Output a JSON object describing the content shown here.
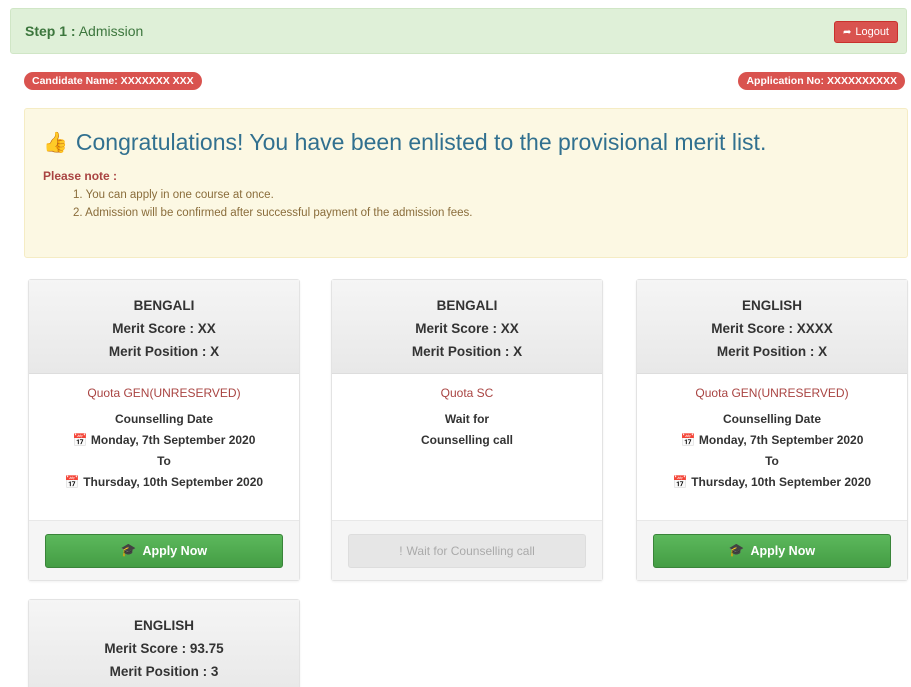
{
  "header": {
    "step_label": "Step 1 :",
    "step_title": "Admission",
    "logout_label": "Logout"
  },
  "candidate": {
    "name_label": "Candidate Name: XXXXXXX XXX",
    "application_label": "Application No: XXXXXXXXXX"
  },
  "notice": {
    "headline": "Congratulations! You have been enlisted to the provisional merit list.",
    "note_label": "Please note :",
    "items": [
      "1. You can apply in one course at once.",
      "2. Admission will be confirmed after successful payment of the admission fees."
    ]
  },
  "cards": [
    {
      "subject": "BENGALI",
      "merit_score": "Merit Score : XX",
      "merit_position": "Merit Position : X",
      "quota": "Quota GEN(UNRESERVED)",
      "line1": "Counselling Date",
      "date_from": "Monday, 7th September 2020",
      "to": "To",
      "date_to": "Thursday, 10th September 2020",
      "button": "Apply Now"
    },
    {
      "subject": "BENGALI",
      "merit_score": "Merit Score : XX",
      "merit_position": "Merit Position : X",
      "quota": "Quota SC",
      "line1": "Wait for",
      "line2": "Counselling call",
      "button": "Wait for Counselling call"
    },
    {
      "subject": "ENGLISH",
      "merit_score": "Merit Score : XXXX",
      "merit_position": "Merit Position : X",
      "quota": "Quota GEN(UNRESERVED)",
      "line1": "Counselling Date",
      "date_from": "Monday, 7th September 2020",
      "to": "To",
      "date_to": "Thursday, 10th September 2020",
      "button": "Apply Now"
    },
    {
      "subject": "ENGLISH",
      "merit_score": "Merit Score : 93.75",
      "merit_position": "Merit Position : 3"
    }
  ],
  "colors": {
    "success_bg": "#dff0d8",
    "danger": "#d9534f",
    "warning_bg": "#fcf8e3",
    "info_text": "#31708f",
    "apply_green": "#5cb85c"
  },
  "icons": {
    "logout": "sign-out-icon",
    "thumbs_up": "thumbs-up-icon",
    "calendar": "calendar-icon",
    "graduation_cap": "graduation-cap-icon",
    "exclamation": "exclamation-icon"
  }
}
